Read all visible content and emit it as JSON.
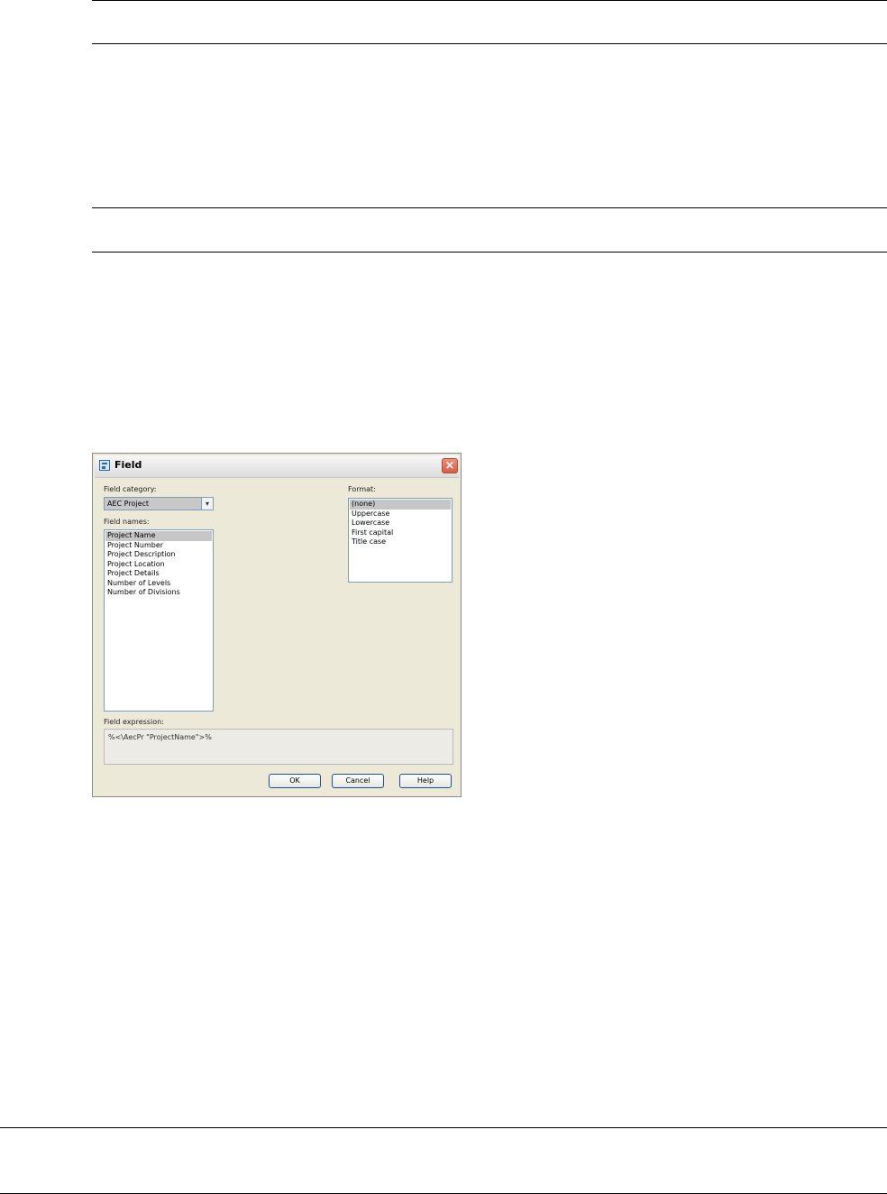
{
  "dialog": {
    "title": "Field",
    "close_glyph": "×",
    "field_category_label": "Field category:",
    "field_category_value": "AEC Project",
    "dropdown_glyph": "▾",
    "field_names_label": "Field names:",
    "field_names": [
      "Project Name",
      "Project Number",
      "Project Description",
      "Project Location",
      "Project Details",
      "Number of Levels",
      "Number of Divisions"
    ],
    "selected_field_name": "Project Name",
    "format_label": "Format:",
    "formats": [
      "(none)",
      "Uppercase",
      "Lowercase",
      "First capital",
      "Title case"
    ],
    "selected_format": "(none)",
    "field_expression_label": "Field expression:",
    "field_expression": "%<\\AecPr \"ProjectName\">%",
    "buttons": {
      "ok": "OK",
      "cancel": "Cancel",
      "help": "Help"
    }
  },
  "icons": {
    "title_icon": "field-dialog-icon",
    "close_icon": "close-icon",
    "dropdown_icon": "chevron-down-icon"
  },
  "colors": {
    "dialog_bg": "#ece9d8",
    "selection": "#c6c6c6",
    "close_button": "#d65e46",
    "button_border": "#1d4f91"
  }
}
